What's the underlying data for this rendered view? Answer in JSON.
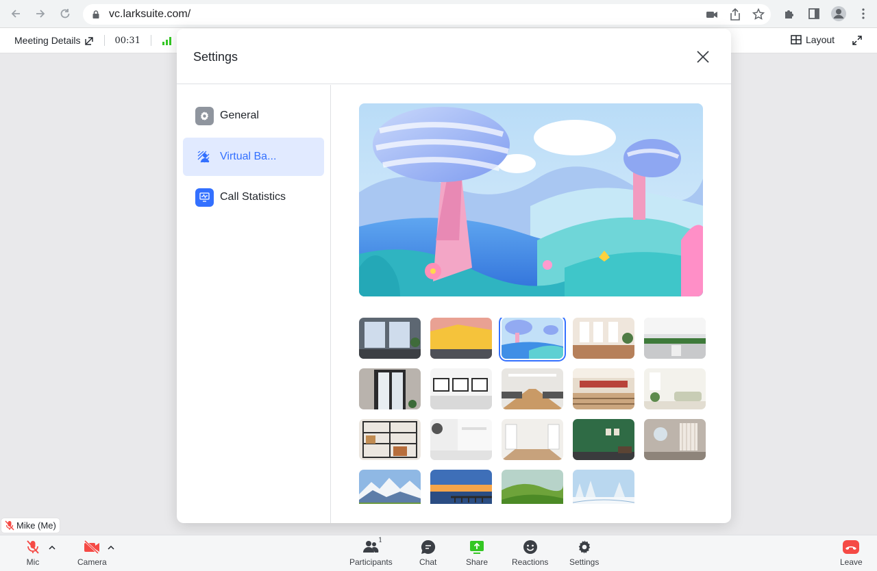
{
  "browser": {
    "url": "vc.larksuite.com/"
  },
  "meeting_bar": {
    "details_label": "Meeting Details",
    "timer": "00:31",
    "layout_label": "Layout"
  },
  "settings": {
    "title": "Settings",
    "nav": [
      {
        "label": "General",
        "icon": "gear-icon"
      },
      {
        "label": "Virtual Ba...",
        "icon": "virtual-background-icon",
        "active": true
      },
      {
        "label": "Call Statistics",
        "icon": "chart-icon"
      }
    ],
    "backgrounds": [
      "office-window",
      "yellow-pink-wall",
      "cartoon-landscape",
      "cafe-interior",
      "open-office-plants",
      "glass-door",
      "meeting-room-white",
      "conference-hall",
      "lecture-hall",
      "bright-living-room",
      "bookshelf",
      "white-corner",
      "empty-room",
      "green-wall",
      "modern-lounge",
      "mountains",
      "sunset-pier",
      "green-hills",
      "snowy-forest"
    ],
    "selected_background_index": 2
  },
  "self_view": {
    "name": "Mike (Me)"
  },
  "bottom_bar": {
    "mic": "Mic",
    "camera": "Camera",
    "participants": "Participants",
    "participants_count": "1",
    "chat": "Chat",
    "share": "Share",
    "reactions": "Reactions",
    "settings": "Settings",
    "leave": "Leave"
  },
  "colors": {
    "accent": "#3370ff",
    "active_bg": "#e1eaff",
    "leave_red": "#f54a45",
    "share_green": "#34c724"
  }
}
